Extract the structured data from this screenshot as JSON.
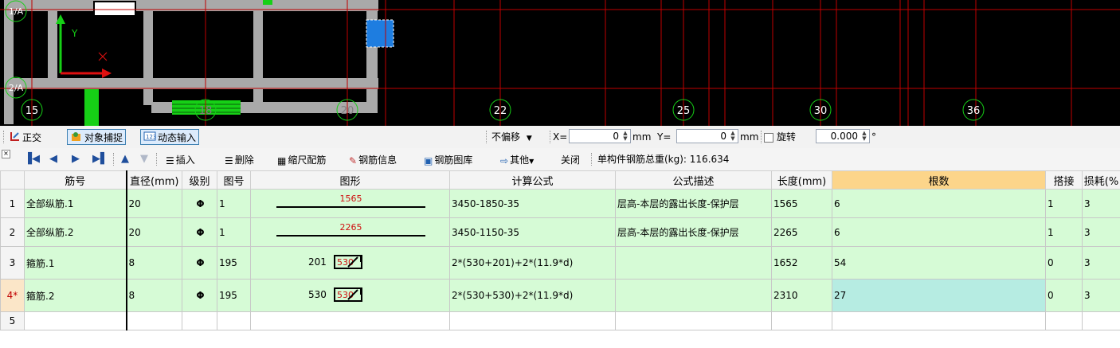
{
  "cad": {
    "axis_labels_left": [
      "1/A",
      "2/A"
    ],
    "axis_numbers": [
      "15",
      "18",
      "20",
      "22",
      "25",
      "30",
      "36"
    ],
    "ucs_y_label": "Y"
  },
  "snapbar": {
    "ortho": "正交",
    "object_snap": "对象捕捉",
    "dynamic_input": "动态输入",
    "offset_mode": "不偏移",
    "x_label": "X=",
    "x_value": "0",
    "mm1": "mm",
    "y_label": "Y=",
    "y_value": "0",
    "mm2": "mm",
    "rotate_label": "旋转",
    "rotate_value": "0.000",
    "degree": "°"
  },
  "gridbar": {
    "insert": "插入",
    "delete": "删除",
    "scale_rebar": "缩尺配筋",
    "rebar_info": "钢筋信息",
    "rebar_library": "钢筋图库",
    "other": "其他",
    "close": "关闭",
    "total_weight": "单构件钢筋总重(kg): 116.634"
  },
  "table": {
    "columns": [
      "",
      "筋号",
      "直径(mm)",
      "级别",
      "图号",
      "图形",
      "计算公式",
      "公式描述",
      "长度(mm)",
      "根数",
      "搭接",
      "损耗(%"
    ],
    "rows": [
      {
        "idx": "1",
        "name": "全部纵筋.1",
        "dia": "20",
        "grade": "Φ",
        "fig": "1",
        "shape_num": "1565",
        "formula": "3450-1850-35",
        "desc": "层高-本层的露出长度-保护层",
        "length": "1565",
        "count": "6",
        "lap": "1",
        "loss": "3"
      },
      {
        "idx": "2",
        "name": "全部纵筋.2",
        "dia": "20",
        "grade": "Φ",
        "fig": "1",
        "shape_num": "2265",
        "formula": "3450-1150-35",
        "desc": "层高-本层的露出长度-保护层",
        "length": "2265",
        "count": "6",
        "lap": "1",
        "loss": "3"
      },
      {
        "idx": "3",
        "name": "箍筋.1",
        "dia": "8",
        "grade": "Φ",
        "fig": "195",
        "shape_left": "201",
        "shape_inner": "530",
        "formula": "2*(530+201)+2*(11.9*d)",
        "desc": "",
        "length": "1652",
        "count": "54",
        "lap": "0",
        "loss": "3"
      },
      {
        "idx": "4*",
        "name": "箍筋.2",
        "dia": "8",
        "grade": "Φ",
        "fig": "195",
        "shape_left": "530",
        "shape_inner": "530",
        "formula": "2*(530+530)+2*(11.9*d)",
        "desc": "",
        "length": "2310",
        "count": "27",
        "lap": "0",
        "loss": "3"
      },
      {
        "idx": "5"
      }
    ]
  },
  "colors": {
    "row_bg": "#d6fbd6",
    "header_highlight": "#fcd58a",
    "cad_bg": "#000000",
    "grid_line": "#c00000"
  }
}
